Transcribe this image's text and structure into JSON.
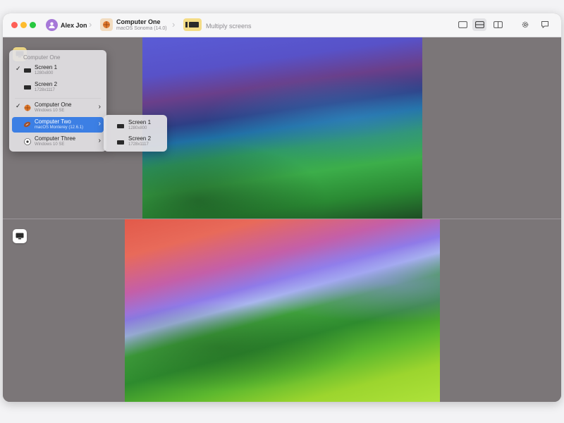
{
  "window": {
    "traffic_lights": [
      "close",
      "minimize",
      "zoom"
    ]
  },
  "toolbar": {
    "user_name": "Alex Jon",
    "computer_name": "Computer One",
    "computer_os": "macOS Sonoma (14.0)",
    "screens_label": "Multiply screens",
    "layout_buttons": [
      "single-view-icon",
      "split-horizontal-icon",
      "split-vertical-icon"
    ],
    "active_layout": "split-horizontal-icon",
    "colors": {
      "accent": "#3c7fe4",
      "chip": "#f4dc86",
      "avatar": "#a678d8"
    }
  },
  "menu": {
    "header": "Computer One",
    "screens": [
      {
        "label": "Screen 1",
        "resolution": "1280x800",
        "checked": true
      },
      {
        "label": "Screen 2",
        "resolution": "1728x1117",
        "checked": false
      }
    ],
    "computers": [
      {
        "label": "Computer One",
        "os": "Windows 10 SE",
        "checked": true,
        "highlighted": false
      },
      {
        "label": "Computer Two",
        "os": "macOS Monterey (12.6.1)",
        "checked": false,
        "highlighted": true
      },
      {
        "label": "Computer Three",
        "os": "Windows 10 SE",
        "checked": false,
        "highlighted": false
      }
    ]
  },
  "submenu": {
    "items": [
      {
        "label": "Screen 1",
        "resolution": "1280x800"
      },
      {
        "label": "Screen 2",
        "resolution": "1728x1117"
      }
    ]
  }
}
